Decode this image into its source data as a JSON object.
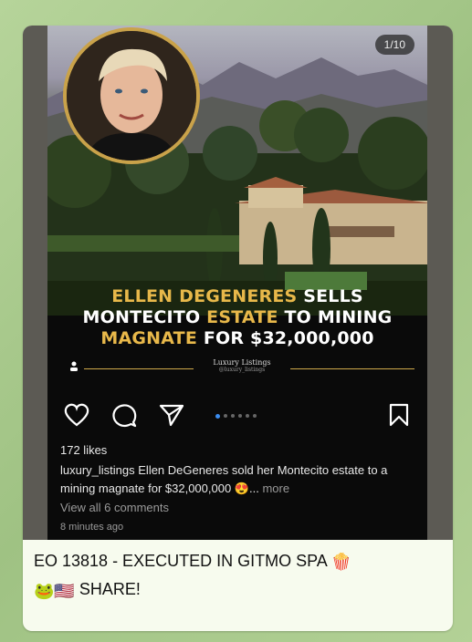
{
  "post": {
    "counter": "1/10",
    "headline_line1_name": "ELLEN DEGENERES",
    "headline_line1_rest": " SELLS",
    "headline_line2_start": "MONTECITO ",
    "headline_line2_estate": "ESTATE",
    "headline_line2_rest": " TO MINING",
    "headline_line3_magnate": "MAGNATE",
    "headline_line3_rest": " FOR $32,000,000",
    "brand_name": "Luxury Listings",
    "brand_handle": "@luxury_listings",
    "likes": "172 likes",
    "caption_text": "luxury_listings Ellen DeGeneres sold her Montecito estate to a mining magnate for $32,000,000 😍...",
    "caption_more": " more",
    "view_comments": "View all 6 comments",
    "time_ago": "8 minutes ago",
    "carousel_dots": 6,
    "active_dot": 0
  },
  "message": {
    "line1": "EO 13818  - EXECUTED IN GITMO SPA",
    "line1_emoji": "🍿",
    "line2_emoji": "🐸🇺🇸",
    "line2_text": " SHARE!"
  },
  "colors": {
    "gold": "#e8b84a",
    "post_bg": "#0a0a0a",
    "bubble_bg": "#f7fbee",
    "link_dot": "#3b8df0"
  },
  "icons": [
    "heart-icon",
    "comment-icon",
    "share-icon",
    "bookmark-icon",
    "person-icon"
  ]
}
